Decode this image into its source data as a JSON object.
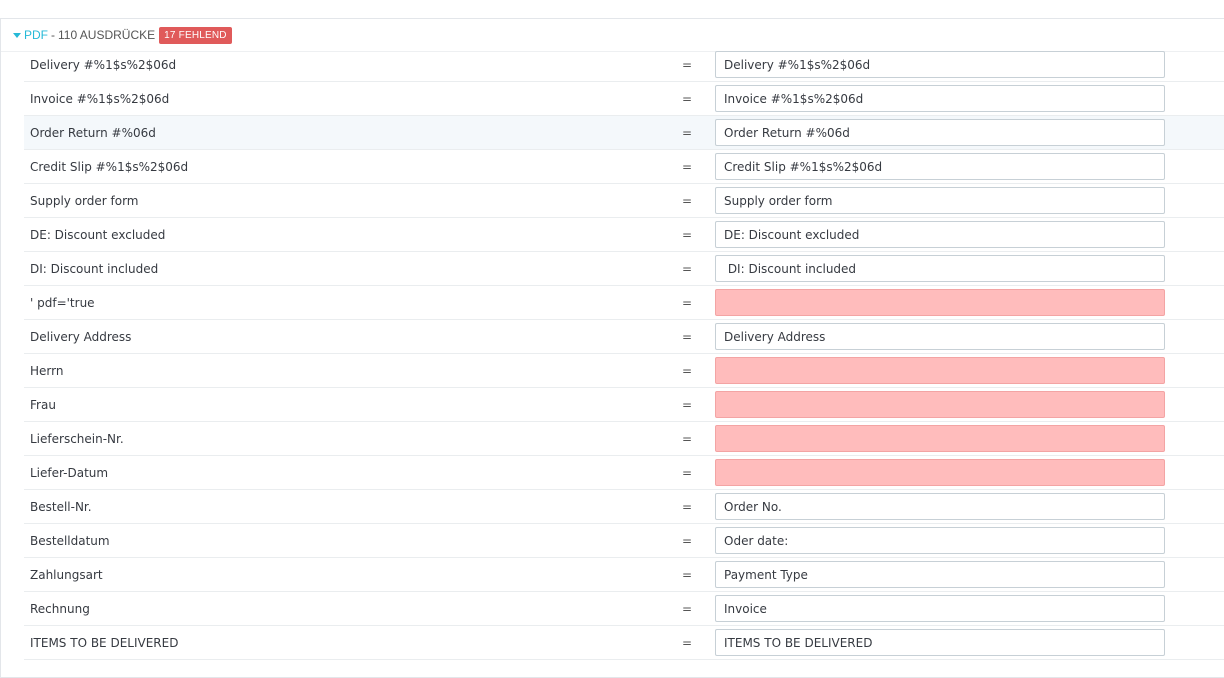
{
  "section": {
    "label": "PDF",
    "separator": "-",
    "count_text": "110 AUSDRÜCKE",
    "badge": "17 FEHLEND"
  },
  "colors": {
    "accent": "#25b9d7",
    "badge": "#e05a5a",
    "missing": "#ffbcbc"
  },
  "icons": {
    "toggle": "caret-down-icon"
  },
  "equals": "=",
  "rows": [
    {
      "source": "Delivery #%1$s%2$06d",
      "value": "Delivery #%1$s%2$06d",
      "missing": false
    },
    {
      "source": "Invoice #%1$s%2$06d",
      "value": "Invoice #%1$s%2$06d",
      "missing": false
    },
    {
      "source": "Order Return #%06d",
      "value": "Order Return #%06d",
      "missing": false
    },
    {
      "source": "Credit Slip #%1$s%2$06d",
      "value": "Credit Slip #%1$s%2$06d",
      "missing": false
    },
    {
      "source": "Supply order form",
      "value": "Supply order form",
      "missing": false
    },
    {
      "source": "DE: Discount excluded",
      "value": "DE: Discount excluded",
      "missing": false
    },
    {
      "source": "DI: Discount included",
      "value": " DI: Discount included",
      "missing": false
    },
    {
      "source": "' pdf='true",
      "value": "",
      "missing": true
    },
    {
      "source": "Delivery Address",
      "value": "Delivery Address",
      "missing": false
    },
    {
      "source": "Herrn",
      "value": "",
      "missing": true
    },
    {
      "source": "Frau",
      "value": "",
      "missing": true
    },
    {
      "source": "Lieferschein-Nr.",
      "value": "",
      "missing": true
    },
    {
      "source": "Liefer-Datum",
      "value": "",
      "missing": true
    },
    {
      "source": "Bestell-Nr.",
      "value": "Order No.",
      "missing": false
    },
    {
      "source": "Bestelldatum",
      "value": "Oder date:",
      "missing": false
    },
    {
      "source": "Zahlungsart",
      "value": "Payment Type",
      "missing": false
    },
    {
      "source": "Rechnung",
      "value": "Invoice",
      "missing": false
    },
    {
      "source": "ITEMS TO BE DELIVERED",
      "value": "ITEMS TO BE DELIVERED",
      "missing": false
    }
  ]
}
